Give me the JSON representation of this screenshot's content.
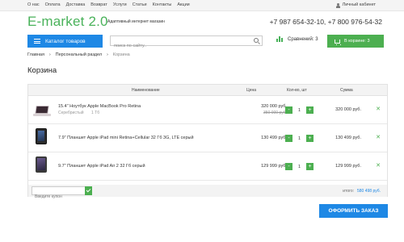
{
  "topnav": {
    "links": [
      "О нас",
      "Оплата",
      "Доставка",
      "Возврат",
      "Услуги",
      "Статьи",
      "Контакты",
      "Акции"
    ],
    "cabinet": "Личный кабинет"
  },
  "header": {
    "logo": "E-market 2.0",
    "tagline": "Адаптивный интернет магазин",
    "phones": "+7 987 654-32-10, +7 800 976-54-32"
  },
  "toolbar": {
    "catalog_label": "Каталог товаров",
    "search_placeholder": "поиск по сайту..",
    "compare_label": "Сравнений: 3",
    "cart_label": "В корзине: 3"
  },
  "breadcrumb": [
    "Главная",
    "Персональный раздел",
    "Корзина"
  ],
  "page_title": "Корзина",
  "table": {
    "headers": {
      "name": "Наименование",
      "price": "Цена",
      "qty": "Кол-во, шт",
      "sum": "Сумма"
    },
    "rows": [
      {
        "name": "15.4\" Ноутбук Apple MacBook Pro Retina",
        "color": "Серебристый",
        "size": "1 Тб",
        "price": "320 000 руб.",
        "old_price": "350 000 руб.",
        "qty": "1",
        "sum": "320 000 руб."
      },
      {
        "name": "7.9\" Планшет Apple iPad mini Retina+Cellular 32 Гб 3G, LTE серый",
        "price": "130 499 руб.",
        "qty": "1",
        "sum": "130 499 руб."
      },
      {
        "name": "9.7\" Планшет Apple iPad Air 2 32 Гб серый",
        "price": "129 999 руб.",
        "qty": "1",
        "sum": "129 999 руб."
      }
    ],
    "minus": "-",
    "plus": "+",
    "remove": "✕"
  },
  "footer": {
    "coupon_placeholder": "Введите купон",
    "total_label": "итого:",
    "total_value": "580 498 руб."
  },
  "order_button": "ОФОРМИТЬ ЗАКАЗ",
  "colors": {
    "green": "#4caf50",
    "blue": "#1e88e5",
    "logo_green": "#49b25a"
  }
}
